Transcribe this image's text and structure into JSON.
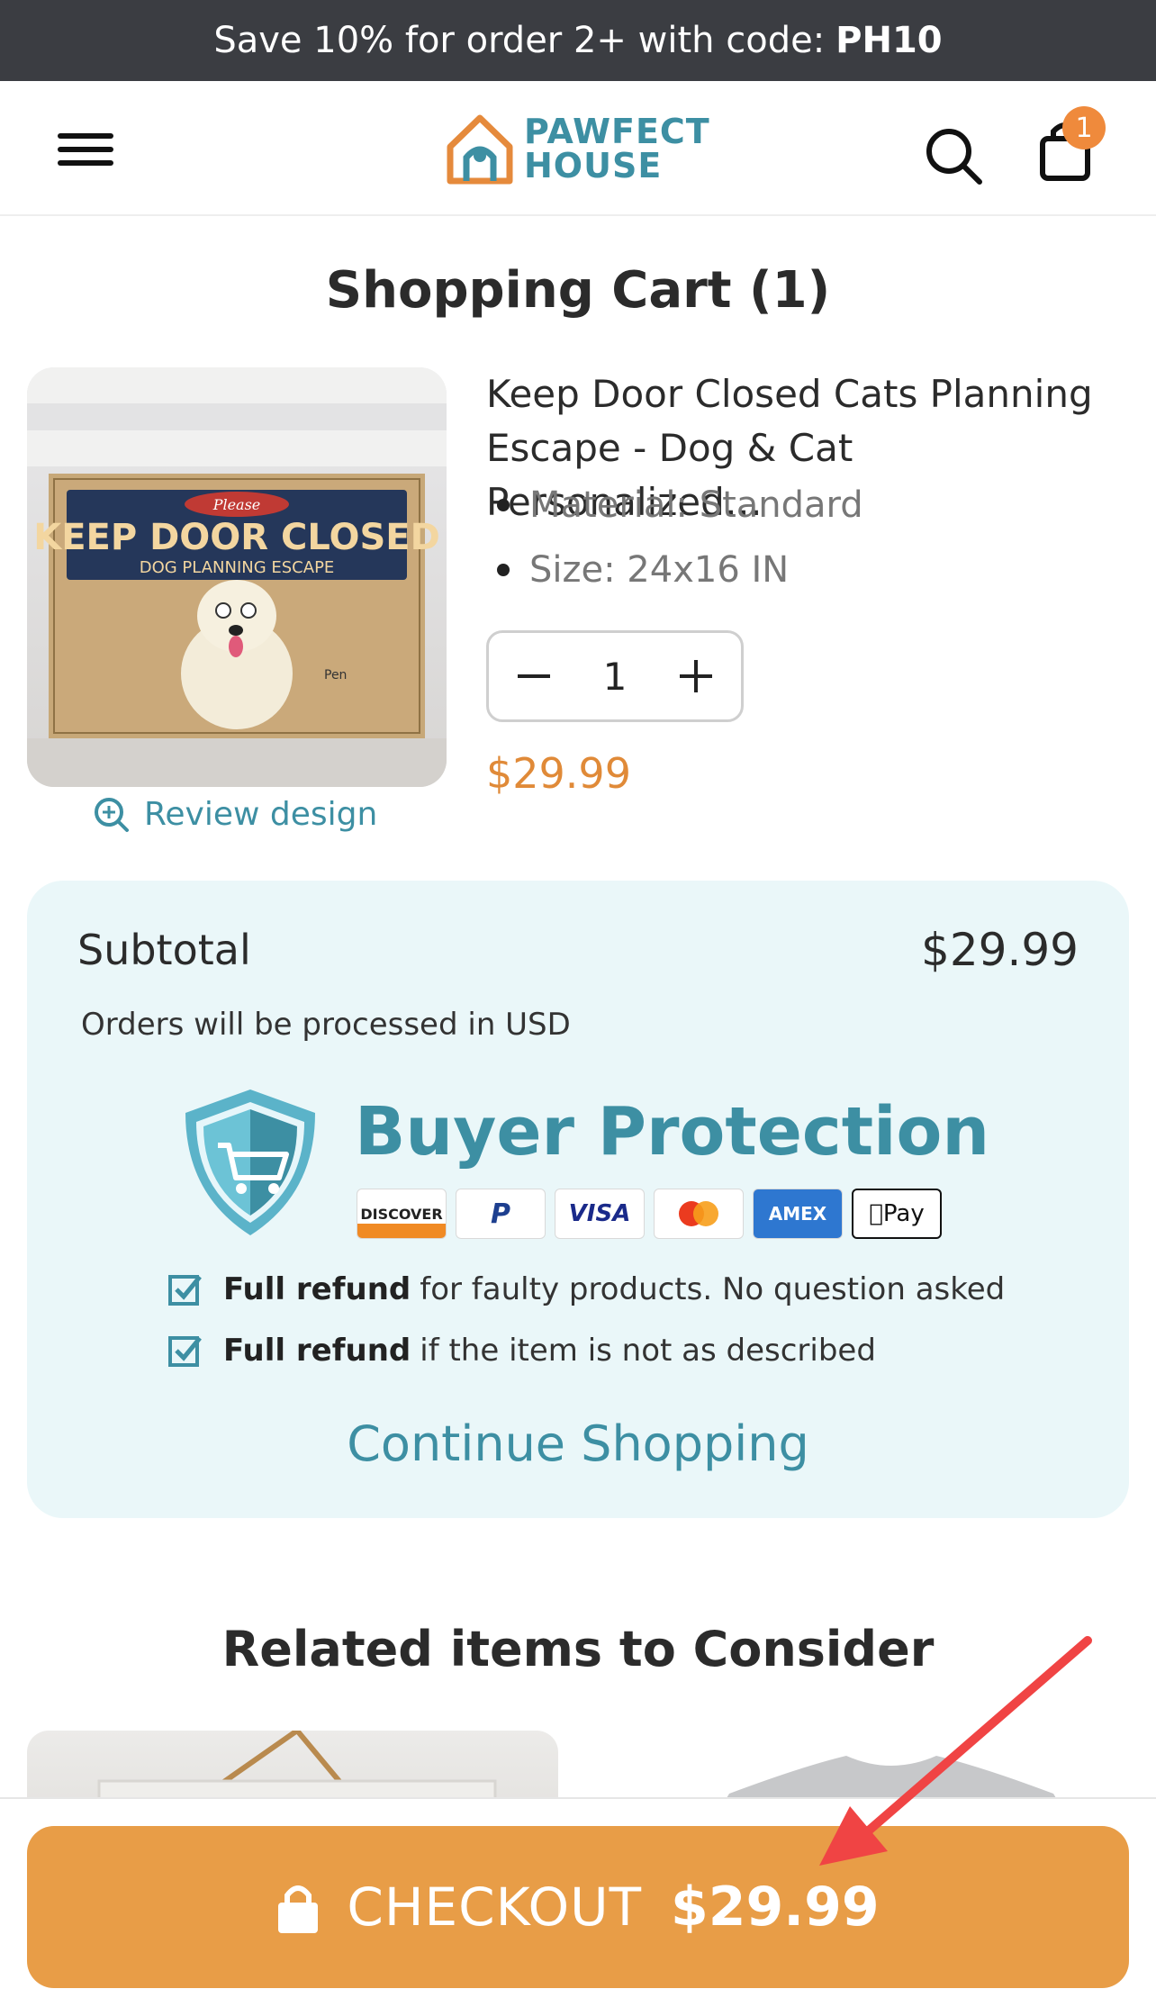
{
  "promo": {
    "text": "Save 10% for order 2+ with code:",
    "code": "PH10"
  },
  "header": {
    "logo_line1": "PAWFECT",
    "logo_line2": "HOUSE",
    "cart_count": "1"
  },
  "cart": {
    "title": "Shopping Cart (1)",
    "item": {
      "name": "Keep Door Closed Cats Planning Escape - Dog & Cat Personalized…",
      "variants": [
        "Material: Standard",
        "Size: 24x16 IN"
      ],
      "quantity": "1",
      "price": "$29.99",
      "review_link": "Review design",
      "image_texts": {
        "please": "Please",
        "headline": "KEEP DOOR CLOSED",
        "subline": "DOG PLANNING ESCAPE",
        "pet_name": "Pen"
      }
    }
  },
  "summary": {
    "subtotal_label": "Subtotal",
    "subtotal_value": "$29.99",
    "currency_note": "Orders will be processed in USD",
    "buyer_protection": "Buyer Protection",
    "payment_methods": [
      "DISCOVER",
      "PayPal",
      "VISA",
      "Mastercard",
      "AMEX",
      "Pay"
    ],
    "guarantees": [
      {
        "bold": "Full refund",
        "text": "for faulty products. No question asked"
      },
      {
        "bold": "Full refund",
        "text": "if the item is not as described"
      }
    ],
    "continue_label": "Continue Shopping"
  },
  "related": {
    "title": "Related items to Consider"
  },
  "checkout": {
    "label": "CHECKOUT",
    "total": "$29.99"
  },
  "colors": {
    "accent": "#3d8fa3",
    "price": "#e08a38",
    "checkout": "#e89d47",
    "summary_bg": "#eaf7f9",
    "promo_bg": "#3b3d42",
    "annotation_arrow": "#f04444"
  }
}
